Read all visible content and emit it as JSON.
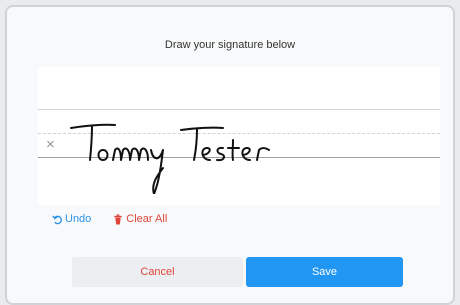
{
  "dialog": {
    "title": "Draw your signature below",
    "signature_text": "Tommy Tester",
    "actions": {
      "undo_label": "Undo",
      "clear_label": "Clear All"
    },
    "buttons": {
      "cancel_label": "Cancel",
      "save_label": "Save"
    },
    "colors": {
      "accent": "#2196f3",
      "danger": "#e0453a"
    },
    "icons": {
      "undo": "undo-icon",
      "clear": "trash-icon",
      "signature_x": "x-mark-icon"
    }
  }
}
